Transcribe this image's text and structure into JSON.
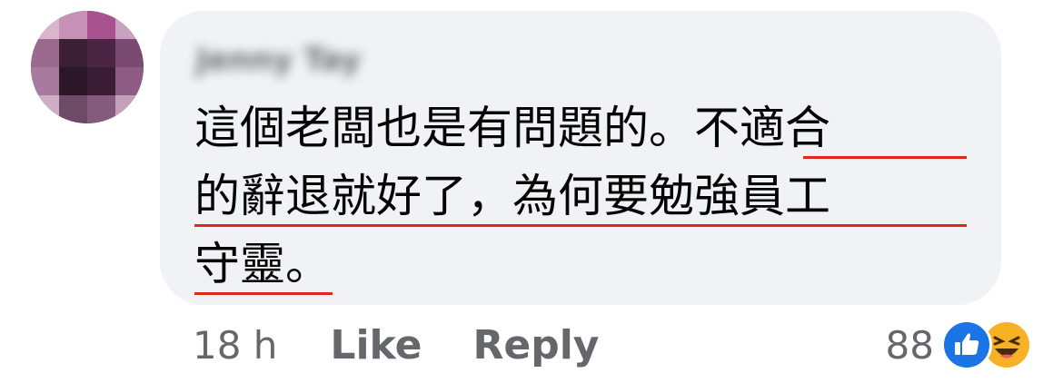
{
  "comment": {
    "author": "Jenny Tay",
    "lines": [
      "這個老闆也是有問題的。不適合",
      "的辭退就好了，為何要勉強員工",
      "守靈。"
    ]
  },
  "meta": {
    "time": "18 h",
    "like_label": "Like",
    "reply_label": "Reply",
    "reaction_count": "88"
  },
  "reaction_icons": [
    "like-icon",
    "haha-icon"
  ],
  "colors": {
    "bubble": "#f0f2f5",
    "underline": "#e0271c",
    "like": "#1b74e4",
    "haha": "#f7b125"
  }
}
